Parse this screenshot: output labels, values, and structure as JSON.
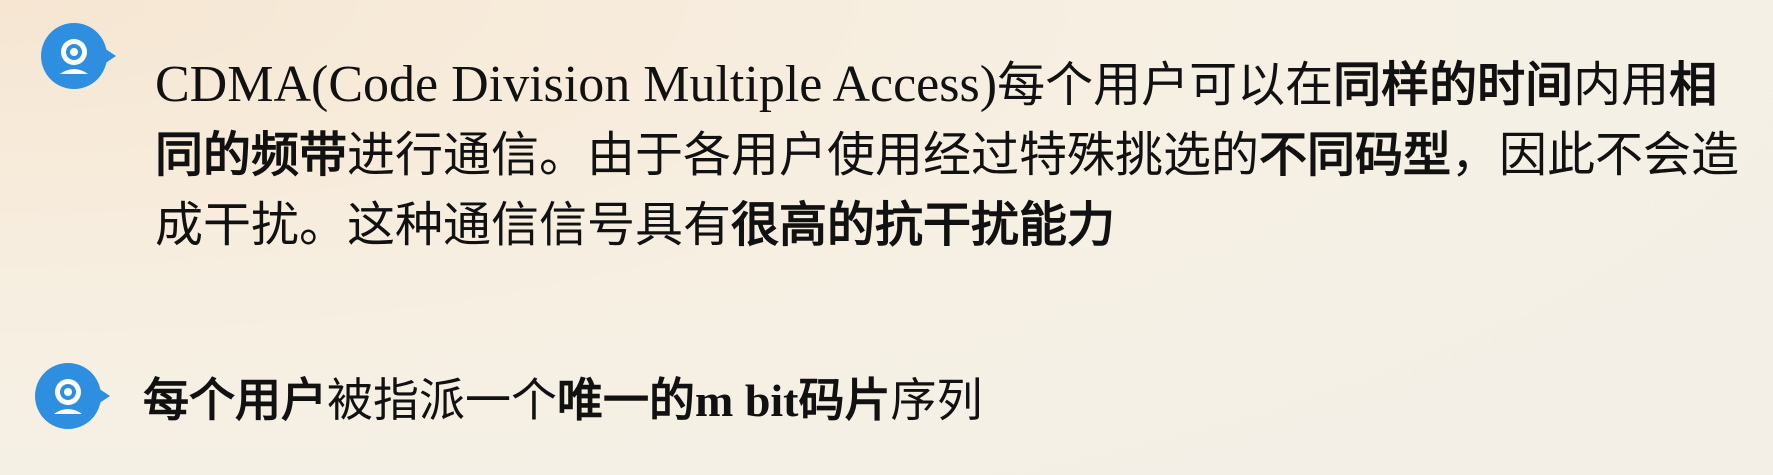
{
  "slide": {
    "bullet1": {
      "icon": "webcam-bubble-icon",
      "segments": [
        {
          "text": "CDMA(Code Division Multiple Access)",
          "style": "latin"
        },
        {
          "text": "每个用户可以在",
          "style": "normal"
        },
        {
          "text": "同样的时间",
          "style": "bold"
        },
        {
          "text": "内用",
          "style": "normal"
        },
        {
          "text": "相同的频带",
          "style": "bold"
        },
        {
          "text": "进行通信。由于各用户使用经过特殊挑选的",
          "style": "normal"
        },
        {
          "text": "不同码型",
          "style": "bold"
        },
        {
          "text": "，因此不会造成干扰。这种通信信号具有",
          "style": "normal"
        },
        {
          "text": "很高的抗干扰能力",
          "style": "bold"
        }
      ]
    },
    "bullet2": {
      "icon": "webcam-bubble-icon",
      "segments": [
        {
          "text": "每个用户",
          "style": "bold"
        },
        {
          "text": "被指派一个",
          "style": "normal"
        },
        {
          "text": "唯一的",
          "style": "bold"
        },
        {
          "text": "m bit",
          "style": "latin-bold"
        },
        {
          "text": "码片",
          "style": "bold"
        },
        {
          "text": "序列",
          "style": "normal"
        }
      ]
    },
    "colors": {
      "icon_blue": "#2e8fe0",
      "icon_dark": "#1f6fc0",
      "text": "#111111"
    }
  }
}
